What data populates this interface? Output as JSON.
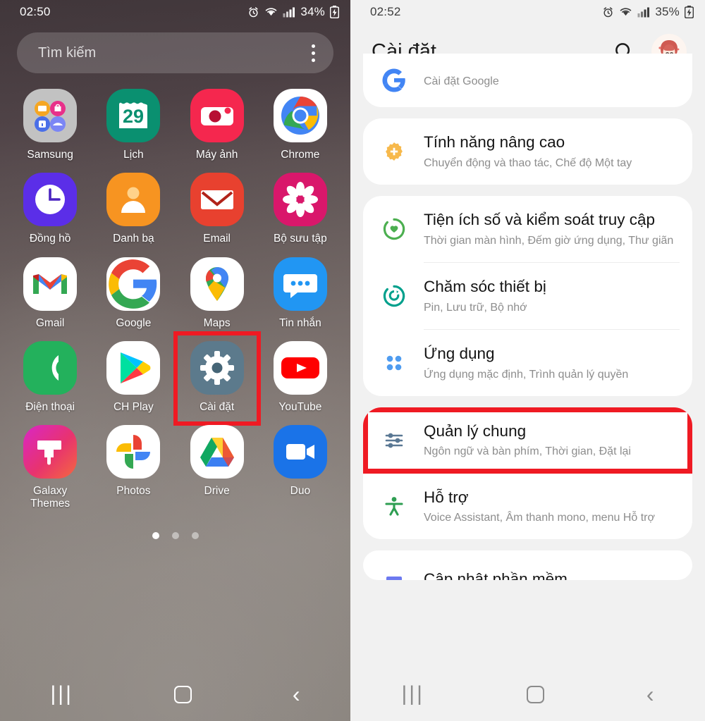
{
  "home": {
    "status": {
      "time": "02:50",
      "battery": "34%",
      "alarm_icon": "alarm-icon",
      "wifi_icon": "wifi-icon",
      "signal_icon": "signal-icon",
      "battery_icon": "battery-charging-icon"
    },
    "search": {
      "placeholder": "Tìm kiếm",
      "menu_icon": "kebab-menu-icon"
    },
    "apps": [
      {
        "label": "Samsung",
        "icon": "samsung-folder-icon"
      },
      {
        "label": "Lịch",
        "icon": "calendar-icon",
        "badge": "29"
      },
      {
        "label": "Máy ảnh",
        "icon": "camera-icon"
      },
      {
        "label": "Chrome",
        "icon": "chrome-icon"
      },
      {
        "label": "Đồng hồ",
        "icon": "clock-icon"
      },
      {
        "label": "Danh bạ",
        "icon": "contacts-icon"
      },
      {
        "label": "Email",
        "icon": "email-icon"
      },
      {
        "label": "Bộ sưu tập",
        "icon": "gallery-icon"
      },
      {
        "label": "Gmail",
        "icon": "gmail-icon"
      },
      {
        "label": "Google",
        "icon": "google-icon"
      },
      {
        "label": "Maps",
        "icon": "maps-icon"
      },
      {
        "label": "Tin nhắn",
        "icon": "messages-icon"
      },
      {
        "label": "Điện thoại",
        "icon": "phone-icon"
      },
      {
        "label": "CH Play",
        "icon": "play-store-icon"
      },
      {
        "label": "Cài đặt",
        "icon": "settings-gear-icon",
        "highlighted": true
      },
      {
        "label": "YouTube",
        "icon": "youtube-icon"
      },
      {
        "label": "Galaxy Themes",
        "icon": "galaxy-themes-icon"
      },
      {
        "label": "Photos",
        "icon": "google-photos-icon"
      },
      {
        "label": "Drive",
        "icon": "google-drive-icon"
      },
      {
        "label": "Duo",
        "icon": "google-duo-icon"
      }
    ],
    "page_dots": {
      "count": 3,
      "active": 0
    },
    "navbar": {
      "recents": "recents-icon",
      "home": "home-icon",
      "back": "back-icon"
    }
  },
  "settings": {
    "status": {
      "time": "02:52",
      "battery": "35%",
      "alarm_icon": "alarm-icon",
      "wifi_icon": "wifi-icon",
      "signal_icon": "signal-icon",
      "battery_icon": "battery-charging-icon"
    },
    "header": {
      "title": "Cài đặt",
      "search_icon": "search-icon",
      "avatar": "user-avatar"
    },
    "groups": [
      {
        "clipped": true,
        "items": [
          {
            "title": "",
            "subtitle": "Cài đặt Google",
            "icon": "google-g-icon",
            "icon_color": "#4285F4"
          }
        ]
      },
      {
        "items": [
          {
            "title": "Tính năng nâng cao",
            "subtitle": "Chuyển động và thao tác, Chế độ Một tay",
            "icon": "advanced-gear-icon",
            "icon_color": "#F7B94C"
          }
        ]
      },
      {
        "items": [
          {
            "title": "Tiện ích số và kiểm soát truy cập",
            "subtitle": "Thời gian màn hình, Đếm giờ ứng dụng, Thư giãn",
            "icon": "digital-wellbeing-icon",
            "icon_color": "#4CAF50"
          },
          {
            "title": "Chăm sóc thiết bị",
            "subtitle": "Pin, Lưu trữ, Bộ nhớ",
            "icon": "device-care-icon",
            "icon_color": "#00A08C"
          },
          {
            "title": "Ứng dụng",
            "subtitle": "Ứng dụng mặc định, Trình quản lý quyền",
            "icon": "apps-grid-icon",
            "icon_color": "#4F9CF0"
          }
        ]
      },
      {
        "items": [
          {
            "title": "Quản lý chung",
            "subtitle": "Ngôn ngữ và bàn phím, Thời gian, Đặt lại",
            "icon": "sliders-icon",
            "icon_color": "#5A7894",
            "highlighted": true
          },
          {
            "title": "Hỗ trợ",
            "subtitle": "Voice Assistant, Âm thanh mono, menu Hỗ trợ",
            "icon": "accessibility-icon",
            "icon_color": "#2E9E52"
          }
        ]
      },
      {
        "cut": true,
        "items": [
          {
            "title": "Cập nhật phần mềm",
            "subtitle": "",
            "icon": "software-update-icon",
            "icon_color": "#6C79F0"
          }
        ]
      }
    ],
    "navbar": {
      "recents": "recents-icon",
      "home": "home-icon",
      "back": "back-icon"
    }
  },
  "colors": {
    "highlight": "#ef1a23",
    "card_bg": "#ffffff",
    "page_bg": "#f1f1f1"
  }
}
